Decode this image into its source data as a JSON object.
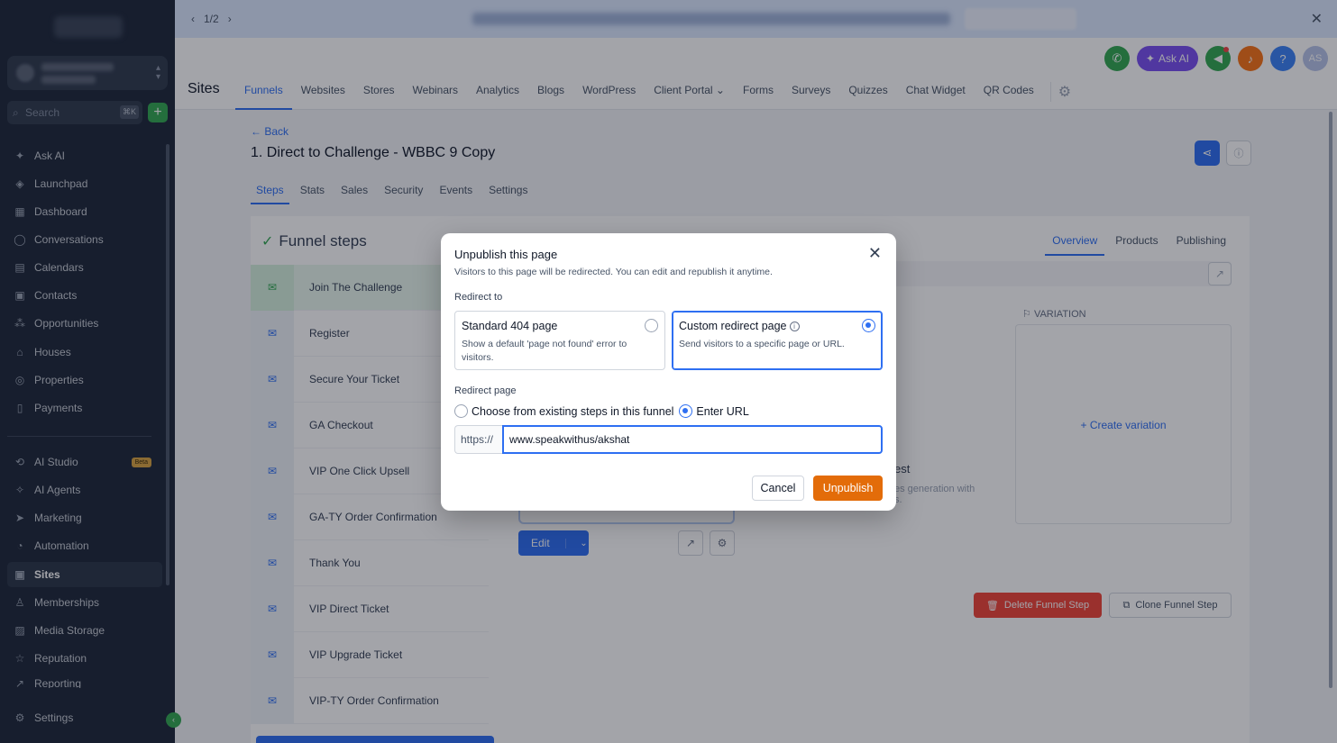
{
  "colors": {
    "accent": "#2e6ff2",
    "unpublish": "#e36c09",
    "success": "#32a852",
    "danger": "#f04438",
    "ask_ai": "#7a4ff0"
  },
  "topbar": {
    "pager": "1/2",
    "close_icon": "close-icon"
  },
  "sidebar": {
    "search_placeholder": "Search",
    "search_shortcut": "⌘K",
    "items": [
      {
        "label": "Ask AI",
        "icon": "sparkle-icon"
      },
      {
        "label": "Launchpad",
        "icon": "rocket-icon"
      },
      {
        "label": "Dashboard",
        "icon": "grid-icon"
      },
      {
        "label": "Conversations",
        "icon": "chat-icon"
      },
      {
        "label": "Calendars",
        "icon": "calendar-icon"
      },
      {
        "label": "Contacts",
        "icon": "contacts-icon"
      },
      {
        "label": "Opportunities",
        "icon": "opportunities-icon"
      },
      {
        "label": "Houses",
        "icon": "house-icon"
      },
      {
        "label": "Properties",
        "icon": "properties-icon"
      },
      {
        "label": "Payments",
        "icon": "payments-icon"
      },
      {
        "label": "AI Studio",
        "icon": "ai-studio-icon",
        "badge": "Beta"
      },
      {
        "label": "AI Agents",
        "icon": "ai-agents-icon"
      },
      {
        "label": "Marketing",
        "icon": "send-icon"
      },
      {
        "label": "Automation",
        "icon": "automation-icon"
      },
      {
        "label": "Sites",
        "icon": "sites-icon"
      },
      {
        "label": "Memberships",
        "icon": "memberships-icon"
      },
      {
        "label": "Media Storage",
        "icon": "image-icon"
      },
      {
        "label": "Reputation",
        "icon": "star-icon"
      },
      {
        "label": "Reporting",
        "icon": "chart-icon"
      }
    ],
    "settings_label": "Settings"
  },
  "header": {
    "section_title": "Sites",
    "ask_ai_label": "Ask AI",
    "avatar_initials": "AS",
    "tabs": [
      "Funnels",
      "Websites",
      "Stores",
      "Webinars",
      "Analytics",
      "Blogs",
      "WordPress",
      "Client Portal",
      "Forms",
      "Surveys",
      "Quizzes",
      "Chat Widget",
      "QR Codes"
    ]
  },
  "funnel": {
    "back_label": "Back",
    "title": "1. Direct to Challenge - WBBC 9 Copy",
    "subtabs": [
      "Steps",
      "Stats",
      "Sales",
      "Security",
      "Events",
      "Settings"
    ],
    "steps_heading": "Funnel steps",
    "steps": [
      "Join The Challenge",
      "Register",
      "Secure Your Ticket",
      "GA Checkout",
      "VIP One Click Upsell",
      "GA-TY Order Confirmation",
      "Thank You",
      "VIP Direct Ticket",
      "VIP Upgrade Ticket",
      "VIP-TY Order Confirmation"
    ]
  },
  "step_detail": {
    "tabs": [
      "Overview",
      "Products",
      "Publishing"
    ],
    "variation_label": "VARIATION",
    "create_variation": "Create variation",
    "abtest_title_fragment": "est",
    "abtest_desc_fragment": "es generation with",
    "abtest_desc_fragment2": "s.",
    "edit_label": "Edit",
    "delete_label": "Delete Funnel Step",
    "clone_label": "Clone Funnel Step"
  },
  "modal": {
    "title": "Unpublish this page",
    "subtitle": "Visitors to this page will be redirected. You can edit and republish it anytime.",
    "redirect_to_label": "Redirect to",
    "option_404_title": "Standard 404 page",
    "option_404_desc": "Show a default 'page not found' error to visitors.",
    "option_custom_title": "Custom redirect page",
    "option_custom_desc": "Send visitors to a specific page or URL.",
    "selected_option": "custom",
    "redirect_page_label": "Redirect page",
    "choose_existing_label": "Choose from existing steps in this funnel",
    "enter_url_label": "Enter URL",
    "url_prefix": "https://",
    "url_value": "www.speakwithus/akshat",
    "cancel_label": "Cancel",
    "unpublish_label": "Unpublish"
  }
}
